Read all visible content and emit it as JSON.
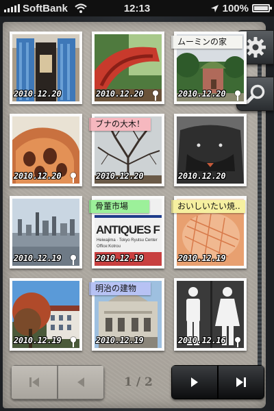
{
  "status_bar": {
    "carrier": "SoftBank",
    "time": "12:13",
    "battery": "100%",
    "icons": [
      "signal-icon",
      "wifi-icon",
      "location-arrow-icon",
      "battery-icon"
    ]
  },
  "side_buttons": [
    {
      "name": "settings",
      "icon": "gear-icon"
    },
    {
      "name": "search",
      "icon": "magnifier-icon"
    }
  ],
  "photos": [
    {
      "date": "2010.12.20",
      "tag": "",
      "tag_color": "",
      "pin": false,
      "scene": "blue-door"
    },
    {
      "date": "2010.12.20",
      "tag": "",
      "tag_color": "",
      "pin": true,
      "scene": "red-slide"
    },
    {
      "date": "2010.12.20",
      "tag": "ムーミンの家",
      "tag_color": "#f4f4f0",
      "pin": true,
      "scene": "moomin-house"
    },
    {
      "date": "2010.12.20",
      "tag": "",
      "tag_color": "",
      "pin": true,
      "scene": "orange-house"
    },
    {
      "date": "2010.12.20",
      "tag": "ブナの大木！",
      "tag_color": "#f6b8bf",
      "pin": false,
      "scene": "bare-tree"
    },
    {
      "date": "2010.12.20",
      "tag": "",
      "tag_color": "",
      "pin": false,
      "scene": "black-bag"
    },
    {
      "date": "2010.12.19",
      "tag": "",
      "tag_color": "",
      "pin": true,
      "scene": "city-skyline"
    },
    {
      "date": "2010.12.19",
      "tag": "骨董市場",
      "tag_color": "#9cf09a",
      "pin": false,
      "scene": "antiques-sign"
    },
    {
      "date": "2010.12.19",
      "tag": "おいしいたい焼..",
      "tag_color": "#f6f0a0",
      "pin": false,
      "scene": "taiyaki"
    },
    {
      "date": "2010.12.19",
      "tag": "",
      "tag_color": "",
      "pin": true,
      "scene": "tree-building"
    },
    {
      "date": "2010.12.19",
      "tag": "明治の建物",
      "tag_color": "#b7c2f4",
      "pin": false,
      "scene": "meiji-building"
    },
    {
      "date": "2010.12.16",
      "tag": "",
      "tag_color": "",
      "pin": true,
      "scene": "restroom-sign"
    }
  ],
  "pager": {
    "indicator": "1 / 2",
    "first_icon": "skip-first-icon",
    "prev_icon": "previous-icon",
    "next_icon": "next-icon",
    "last_icon": "skip-last-icon"
  },
  "antiques_sign_text": "ANTIQUES F",
  "antiques_sign_sub": "Heiwajima · Tokyo Ryutsu Center",
  "antiques_sign_sub2": "Office:Kotrou"
}
